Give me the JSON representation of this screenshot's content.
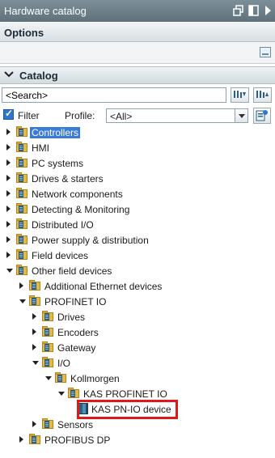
{
  "window": {
    "title": "Hardware catalog",
    "icons": [
      "restore-icon",
      "split-icon",
      "collapse-right-icon"
    ]
  },
  "options": {
    "label": "Options"
  },
  "catalog": {
    "label": "Catalog",
    "search_value": "<Search>",
    "filter_label": "Filter",
    "filter_checked": true,
    "profile_label": "Profile:",
    "profile_value": "<All>"
  },
  "tree": [
    {
      "label": "Controllers",
      "state": "closed",
      "selected": true
    },
    {
      "label": "HMI",
      "state": "closed"
    },
    {
      "label": "PC systems",
      "state": "closed"
    },
    {
      "label": "Drives & starters",
      "state": "closed"
    },
    {
      "label": "Network components",
      "state": "closed"
    },
    {
      "label": "Detecting & Monitoring",
      "state": "closed"
    },
    {
      "label": "Distributed I/O",
      "state": "closed"
    },
    {
      "label": "Power supply & distribution",
      "state": "closed"
    },
    {
      "label": "Field devices",
      "state": "closed"
    },
    {
      "label": "Other field devices",
      "state": "open"
    },
    {
      "label": "Additional Ethernet devices",
      "state": "closed"
    },
    {
      "label": "PROFINET IO",
      "state": "open"
    },
    {
      "label": "Drives",
      "state": "closed"
    },
    {
      "label": "Encoders",
      "state": "closed"
    },
    {
      "label": "Gateway",
      "state": "closed"
    },
    {
      "label": "I/O",
      "state": "open"
    },
    {
      "label": "Kollmorgen",
      "state": "open"
    },
    {
      "label": "KAS PROFINET IO",
      "state": "open"
    },
    {
      "label": "KAS PN-IO device",
      "state": "leaf",
      "highlighted": true
    },
    {
      "label": "Sensors",
      "state": "closed"
    },
    {
      "label": "PROFIBUS DP",
      "state": "closed"
    }
  ],
  "colors": {
    "highlight_box": "#e0171b",
    "selection": "#3a7bd5",
    "titlebar": "#6b7f89"
  }
}
